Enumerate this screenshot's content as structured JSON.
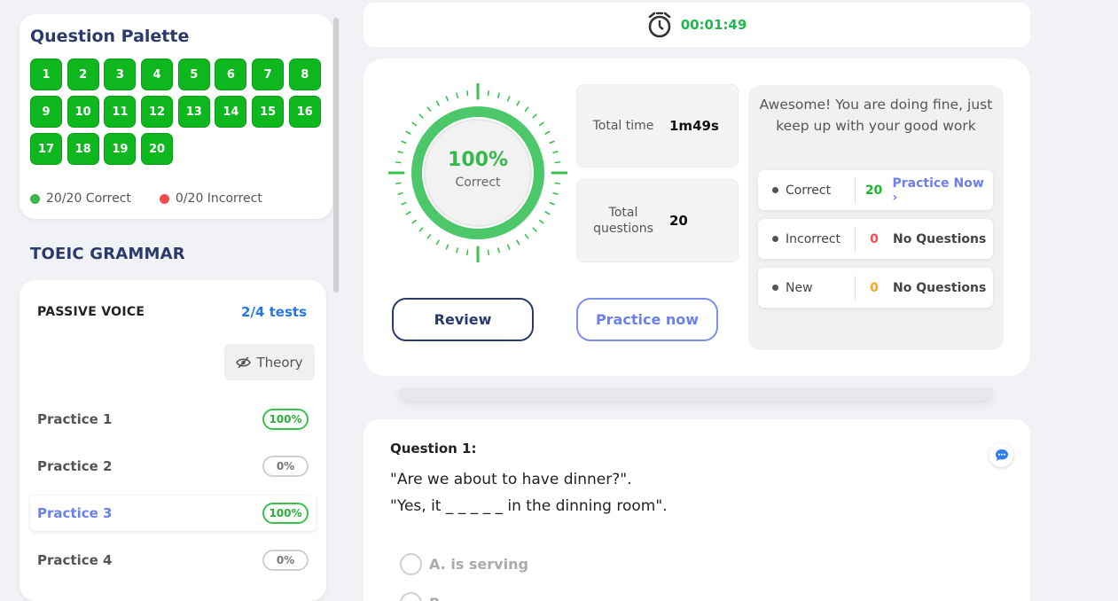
{
  "palette": {
    "title": "Question Palette",
    "questions": [
      "1",
      "2",
      "3",
      "4",
      "5",
      "6",
      "7",
      "8",
      "9",
      "10",
      "11",
      "12",
      "13",
      "14",
      "15",
      "16",
      "17",
      "18",
      "19",
      "20"
    ],
    "correct_text": "20/20 Correct",
    "incorrect_text": "0/20 Incorrect",
    "correct_color": "#0fb71f"
  },
  "course": {
    "title": "TOEIC GRAMMAR",
    "lesson": "PASSIVE VOICE",
    "progress": "2/4 tests",
    "theory_label": "Theory",
    "practices": [
      {
        "label": "Practice 1",
        "score": "100%"
      },
      {
        "label": "Practice 2",
        "score": "0%"
      },
      {
        "label": "Practice 3",
        "score": "100%"
      },
      {
        "label": "Practice 4",
        "score": "0%"
      }
    ]
  },
  "timer": {
    "value": "00:01:49",
    "icon": "alarm-clock-icon"
  },
  "result": {
    "percent": "100%",
    "percent_label": "Correct",
    "percent_value": 1.0,
    "total_time_label": "Total time",
    "total_time": "1m49s",
    "total_questions_label": "Total questions",
    "total_questions": "20",
    "review_label": "Review",
    "practice_label": "Practice now",
    "message": "Awesome! You are doing fine, just keep up with your good work",
    "rows": [
      {
        "label": "Correct",
        "count": "20",
        "action": "Practice Now",
        "count_color": "#18b82a"
      },
      {
        "label": "Incorrect",
        "count": "0",
        "action": "No Questions",
        "count_color": "#f04d4d"
      },
      {
        "label": "New",
        "count": "0",
        "action": "No Questions",
        "count_color": "#f5a623"
      }
    ]
  },
  "question": {
    "title": "Question 1:",
    "line1": "\"Are we about to have dinner?\".",
    "line2": "\"Yes, it _ _ _ _ _ in the dinning room\".",
    "option_a": "A. is serving",
    "option_b": "B."
  }
}
